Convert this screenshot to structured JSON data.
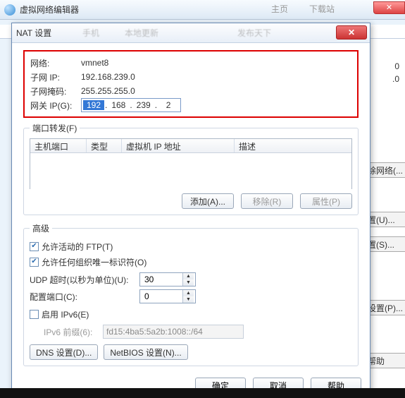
{
  "bg": {
    "title": "虚拟网络编辑器",
    "toolbar": {
      "t1": "主页",
      "t2": "下载站"
    },
    "right": {
      "val0": "0",
      "valIp": ".0",
      "btnRemove": "除网络(...",
      "btnSetU": "置(U)...",
      "btnSetS": "置(S)...",
      "btnSetP": "设置(P)...",
      "btnHelp": "帮助"
    }
  },
  "dialog": {
    "title": "NAT 设置",
    "ghost1": "手机",
    "ghost2": "本地更新",
    "ghost3": "发布天下",
    "info": {
      "net_lbl": "网络:",
      "net_val": "vmnet8",
      "sub_lbl": "子网 IP:",
      "sub_val": "192.168.239.0",
      "mask_lbl": "子网掩码:",
      "mask_val": "255.255.255.0",
      "gw_lbl": "网关 IP(G):",
      "gw_oct1": "192",
      "gw_oct2": "168",
      "gw_oct3": "239",
      "gw_oct4": "2"
    },
    "portfwd": {
      "legend": "端口转发(F)",
      "col1": "主机端口",
      "col2": "类型",
      "col3": "虚拟机 IP 地址",
      "col4": "描述",
      "add": "添加(A)...",
      "remove": "移除(R)",
      "prop": "属性(P)"
    },
    "adv": {
      "legend": "高级",
      "ftp": "允许活动的 FTP(T)",
      "org": "允许任何组织唯一标识符(O)",
      "udp_lbl": "UDP 超时(以秒为单位)(U):",
      "udp_val": "30",
      "cfgport_lbl": "配置端口(C):",
      "cfgport_val": "0",
      "ipv6": "启用 IPv6(E)",
      "ipv6pre_lbl": "IPv6 前缀(6):",
      "ipv6pre_val": "fd15:4ba5:5a2b:1008::/64",
      "dns": "DNS 设置(D)...",
      "netbios": "NetBIOS 设置(N)..."
    },
    "footer": {
      "ok": "确定",
      "cancel": "取消",
      "help": "帮助"
    }
  }
}
